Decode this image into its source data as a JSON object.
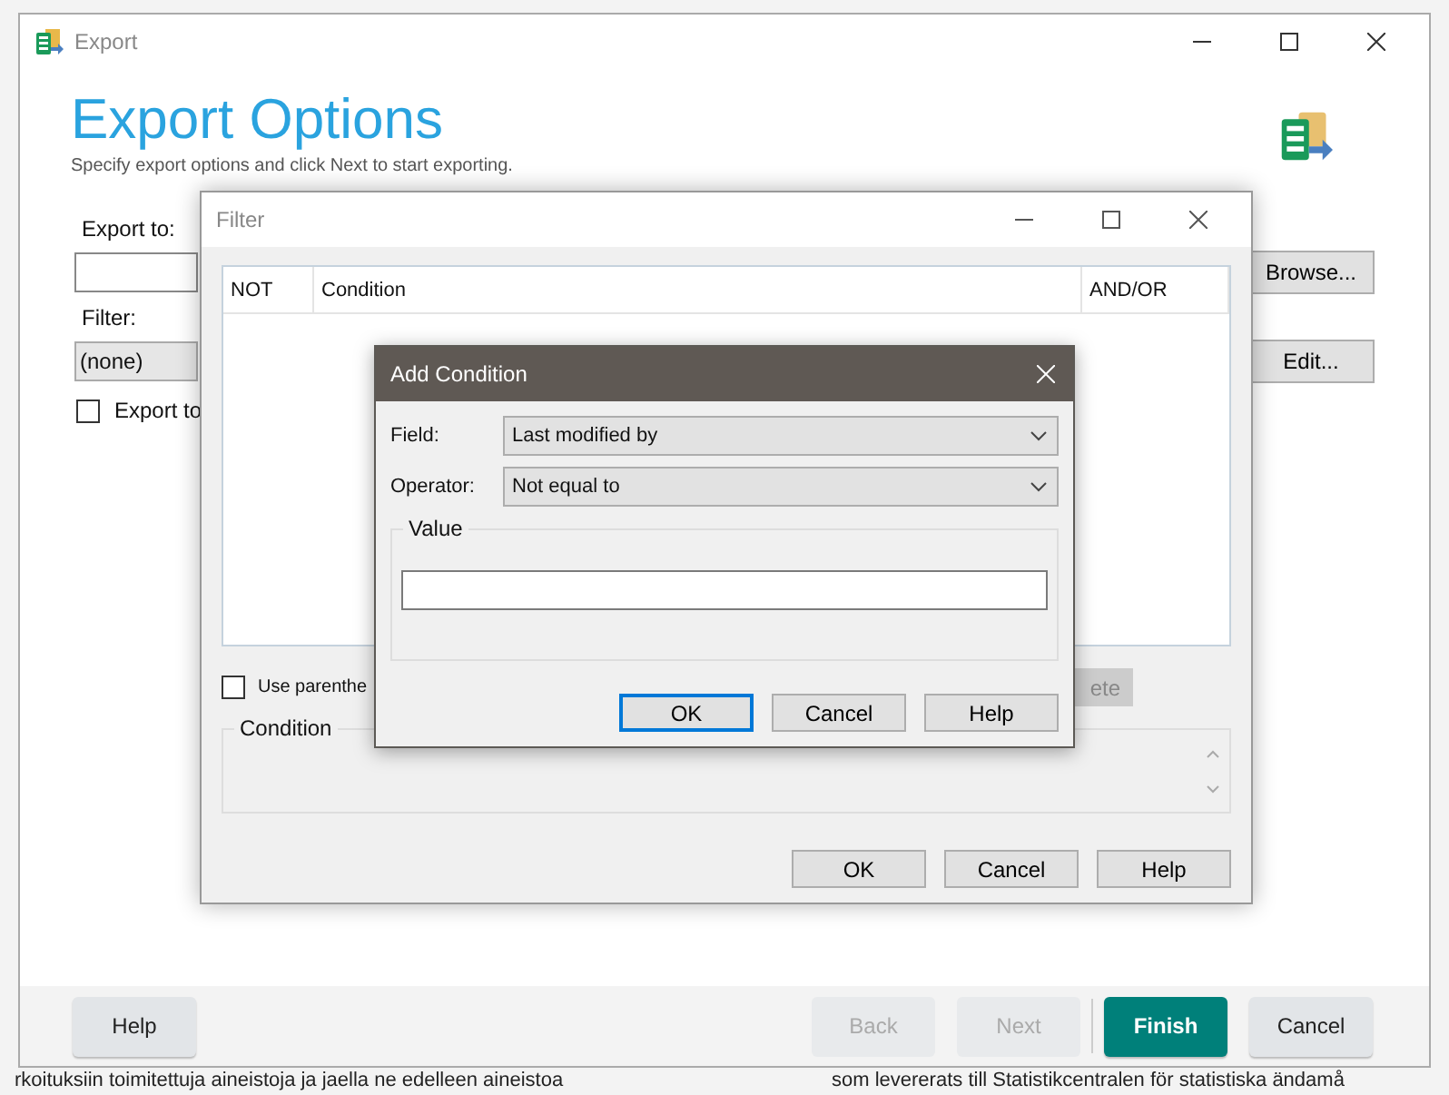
{
  "background_texts": [
    "rkoituksiin toimitettuja aineistoja ja jaella ne edelleen aineistoa",
    "som levererats till Statistikcentralen för statistiska ändamå"
  ],
  "export_window": {
    "title": "Export",
    "heading": "Export Options",
    "subtitle": "Specify export options and click Next to start exporting.",
    "export_to_label": "Export to:",
    "filter_label": "Filter:",
    "filter_value": "(none)",
    "checkbox_label": "Export to",
    "checked": false,
    "browse_button": "Browse...",
    "edit_button": "Edit...",
    "buttons": [
      {
        "label": "Help",
        "kind": "normal",
        "disabled": false
      },
      {
        "label": "Back",
        "kind": "normal",
        "disabled": true
      },
      {
        "label": "Next",
        "kind": "normal",
        "disabled": true
      },
      {
        "label": "Finish",
        "kind": "primary",
        "disabled": false
      },
      {
        "label": "Cancel",
        "kind": "normal",
        "disabled": false
      }
    ]
  },
  "filter_window": {
    "title": "Filter",
    "columns": [
      "NOT",
      "Condition",
      "AND/OR"
    ],
    "checkbox_label": "Use parenthe",
    "checked": false,
    "hidden_button": "ete",
    "condition_group": "Condition",
    "buttons": [
      "OK",
      "Cancel",
      "Help"
    ]
  },
  "add_condition": {
    "title": "Add Condition",
    "field_label": "Field:",
    "field_value": "Last modified by",
    "operator_label": "Operator:",
    "operator_value": "Not equal to",
    "value_group": "Value",
    "buttons": [
      {
        "label": "OK",
        "focused": true
      },
      {
        "label": "Cancel",
        "focused": false
      },
      {
        "label": "Help",
        "focused": false
      }
    ]
  }
}
